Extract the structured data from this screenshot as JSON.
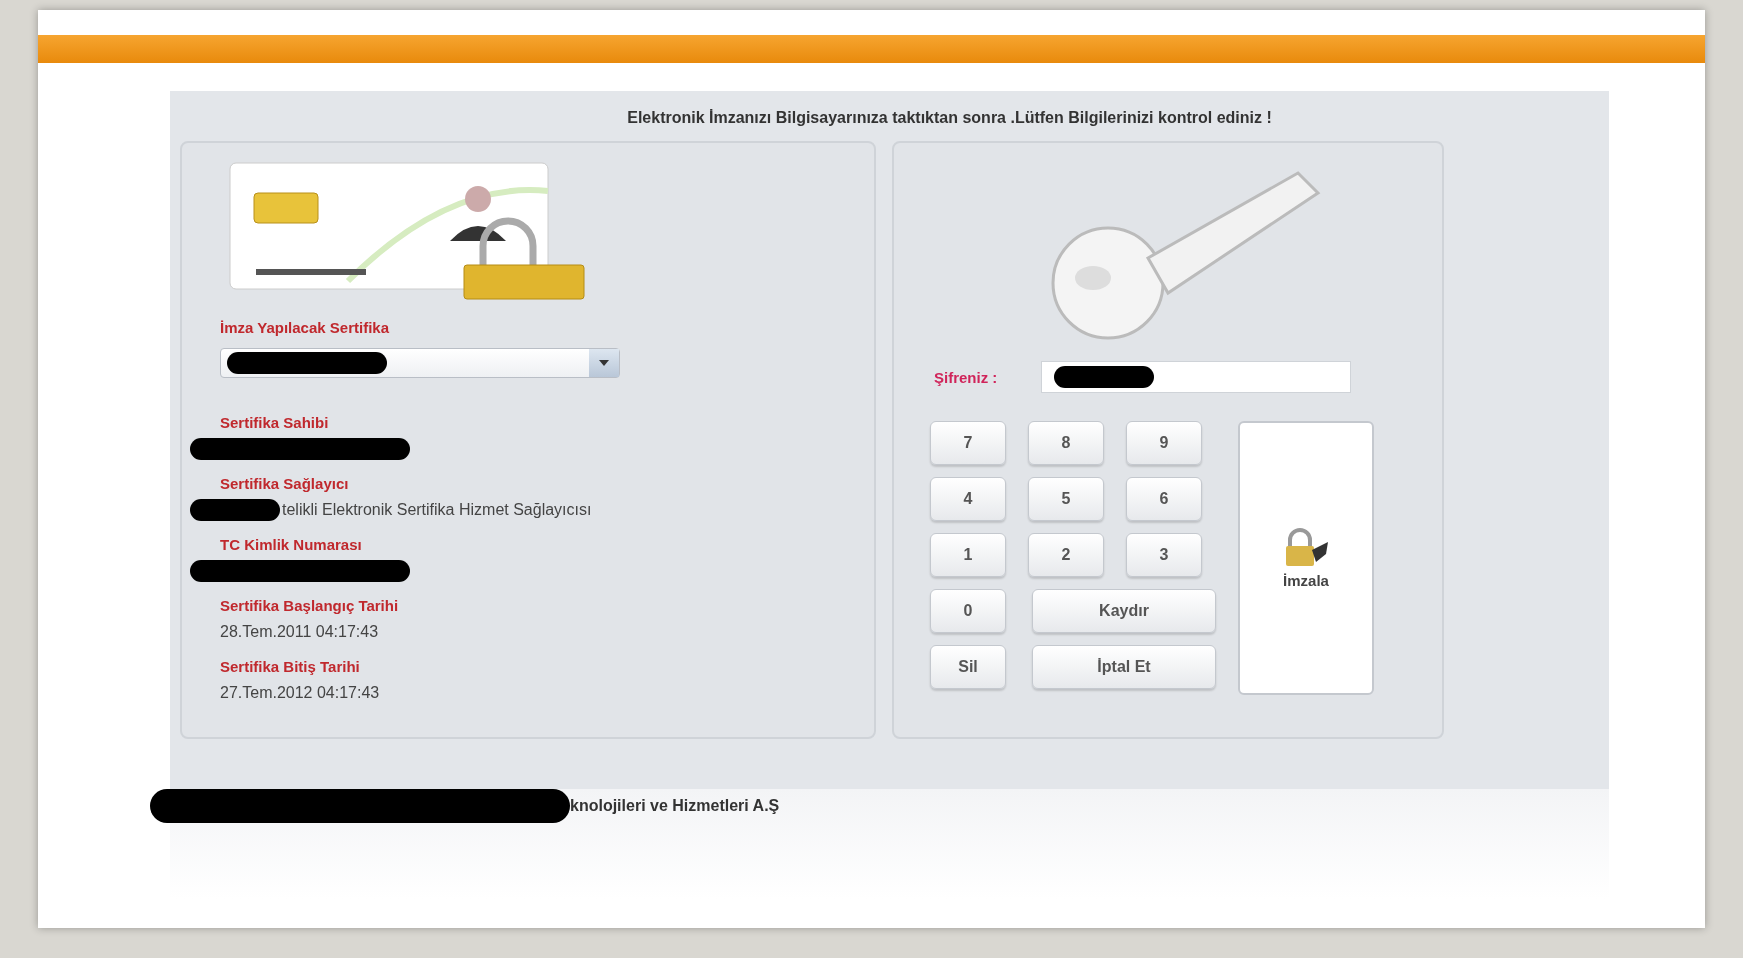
{
  "instruction": "Elektronik İmzanızı Bilgisayarınıza taktıktan sonra .Lütfen Bilgilerinizi kontrol ediniz !",
  "certificate_select": {
    "label": "İmza Yapılacak Sertifika",
    "redacted": true
  },
  "fields": [
    {
      "label": "Sertifika Sahibi",
      "redacted": true
    },
    {
      "label": "Sertifika Sağlayıcı",
      "redacted": true,
      "value": "telikli Elektronik Sertifika Hizmet Sağlayıcısı"
    },
    {
      "label": "TC Kimlik Numarası",
      "redacted": true
    },
    {
      "label": "Sertifika Başlangıç Tarihi",
      "redacted": false,
      "value": "28.Tem.2011 04:17:43"
    },
    {
      "label": "Sertifika Bitiş Tarihi",
      "redacted": false,
      "value": "27.Tem.2012 04:17:43"
    }
  ],
  "password": {
    "label": "Şifreniz :",
    "redacted": true
  },
  "keypad_rows": [
    [
      {
        "label": "7",
        "kind": "small"
      },
      {
        "label": "8",
        "kind": "small"
      },
      {
        "label": "9",
        "kind": "small"
      }
    ],
    [
      {
        "label": "4",
        "kind": "small"
      },
      {
        "label": "5",
        "kind": "small"
      },
      {
        "label": "6",
        "kind": "small"
      }
    ],
    [
      {
        "label": "1",
        "kind": "small"
      },
      {
        "label": "2",
        "kind": "small"
      },
      {
        "label": "3",
        "kind": "small"
      }
    ],
    [
      {
        "label": "0",
        "kind": "small"
      },
      {
        "label": "Kaydır",
        "kind": "wide"
      }
    ],
    [
      {
        "label": "Sil",
        "kind": "small"
      },
      {
        "label": "İptal Et",
        "kind": "wide"
      }
    ]
  ],
  "sign_button": {
    "label": "İmzala"
  },
  "footer": {
    "text": "knolojileri ve Hizmetleri A.Ş",
    "redacted": true
  }
}
